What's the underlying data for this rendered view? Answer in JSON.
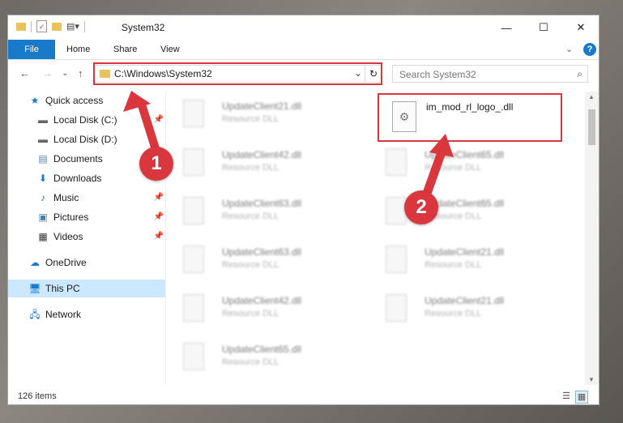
{
  "window": {
    "title": "System32",
    "controls": {
      "minimize": "—",
      "maximize": "☐",
      "close": "✕"
    }
  },
  "ribbon": {
    "tabs": [
      {
        "label": "File"
      },
      {
        "label": "Home"
      },
      {
        "label": "Share"
      },
      {
        "label": "View"
      }
    ],
    "expand_glyph": "⌄",
    "help_glyph": "?"
  },
  "navigation": {
    "address": "C:\\Windows\\System32",
    "search_placeholder": "Search System32"
  },
  "sidebar": {
    "quick_access": "Quick access",
    "items": [
      {
        "label": "Local Disk (C:)",
        "icon": "drive-icon",
        "pinned": true
      },
      {
        "label": "Local Disk (D:)",
        "icon": "drive-icon",
        "pinned": false
      },
      {
        "label": "Documents",
        "icon": "documents-icon",
        "pinned": true
      },
      {
        "label": "Downloads",
        "icon": "downloads-icon",
        "pinned": true
      },
      {
        "label": "Music",
        "icon": "music-icon",
        "pinned": true
      },
      {
        "label": "Pictures",
        "icon": "pictures-icon",
        "pinned": true
      },
      {
        "label": "Videos",
        "icon": "videos-icon",
        "pinned": true
      }
    ],
    "onedrive": "OneDrive",
    "this_pc": "This PC",
    "network": "Network"
  },
  "files": {
    "left_column": [
      {
        "name": "UpdateClient21.dll",
        "type": "Resource DLL"
      },
      {
        "name": "UpdateClient42.dll",
        "type": "Resource DLL"
      },
      {
        "name": "UpdateClient63.dll",
        "type": "Resource DLL"
      },
      {
        "name": "UpdateClient63.dll",
        "type": "Resource DLL"
      },
      {
        "name": "UpdateClient42.dll",
        "type": "Resource DLL"
      },
      {
        "name": "UpdateClient65.dll",
        "type": "Resource DLL"
      }
    ],
    "right_column": [
      {
        "name": "UpdateClient65.dll",
        "type": "Resource DLL"
      },
      {
        "name": "UpdateClient65.dll",
        "type": "Resource DLL"
      },
      {
        "name": "UpdateClient21.dll",
        "type": "Resource DLL"
      },
      {
        "name": "UpdateClient21.dll",
        "type": "Resource DLL"
      }
    ],
    "highlighted": {
      "name": "im_mod_rl_logo_.dll"
    }
  },
  "status": {
    "item_count": "126 items"
  },
  "annotations": {
    "badge_1": "1",
    "badge_2": "2"
  },
  "colors": {
    "accent": "#1979ca",
    "annotation_red": "#d9363e",
    "selection": "#cce8ff"
  }
}
